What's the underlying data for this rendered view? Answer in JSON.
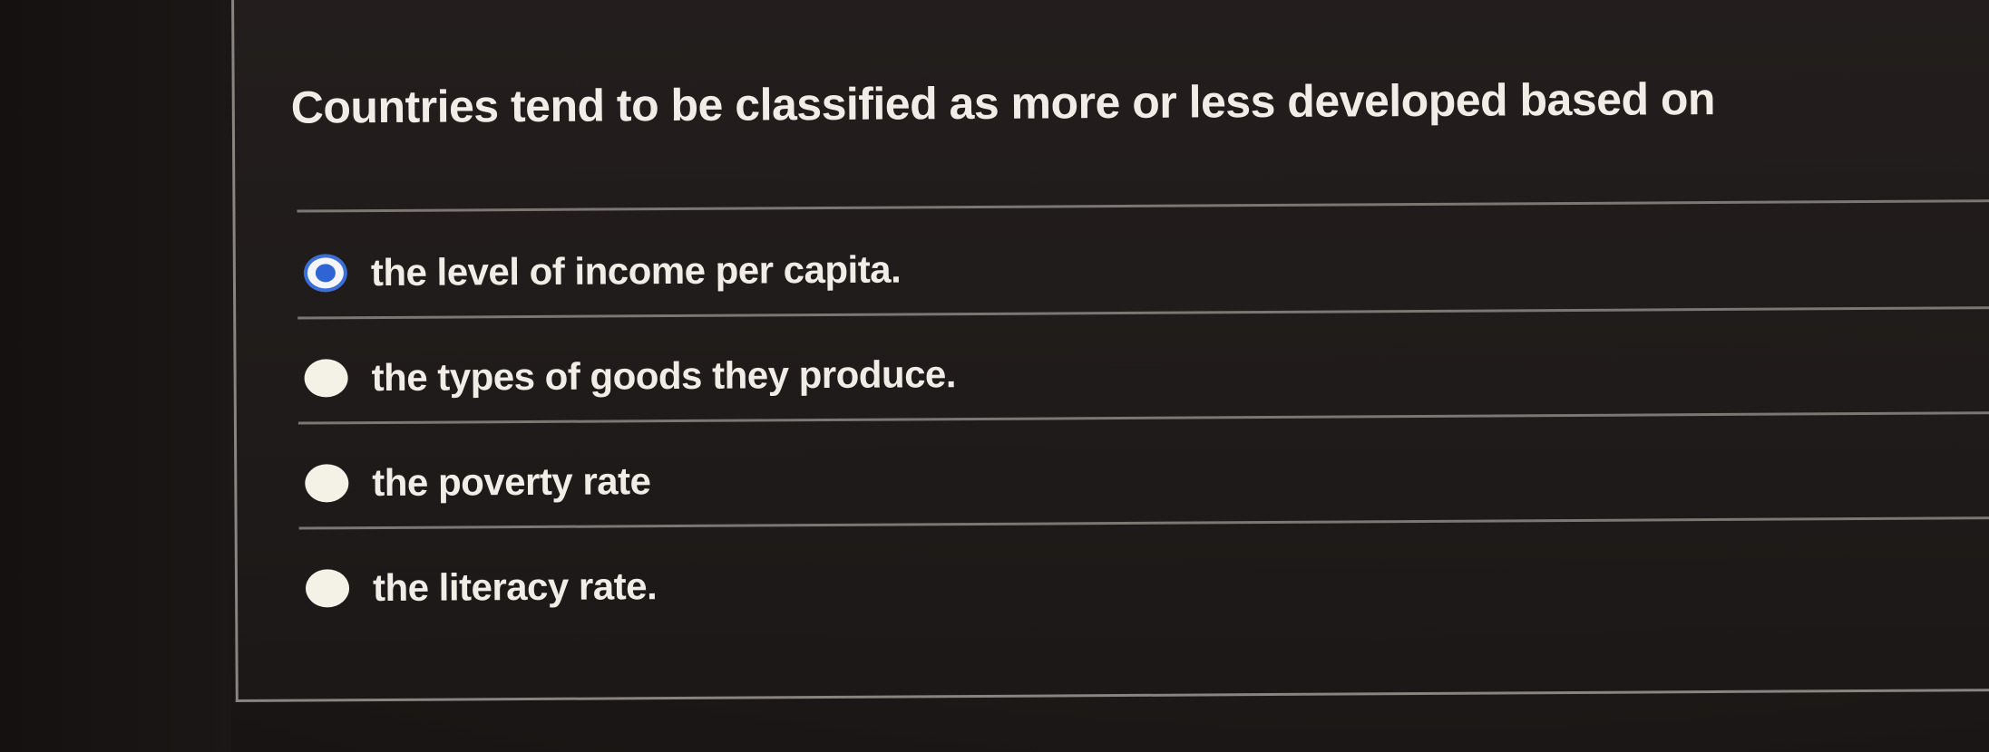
{
  "question": {
    "text": "Countries tend to be classified as more or less developed based on"
  },
  "options": [
    {
      "label": "the level of income per capita.",
      "selected": true
    },
    {
      "label": "the types of goods they produce.",
      "selected": false
    },
    {
      "label": "the poverty rate",
      "selected": false
    },
    {
      "label": "the literacy rate.",
      "selected": false
    }
  ],
  "colors": {
    "background": "#1c1817",
    "text": "#f1ece6",
    "radio_fill": "#f4f1e6",
    "radio_selected": "#2e64d4",
    "divider": "#7c7773"
  }
}
